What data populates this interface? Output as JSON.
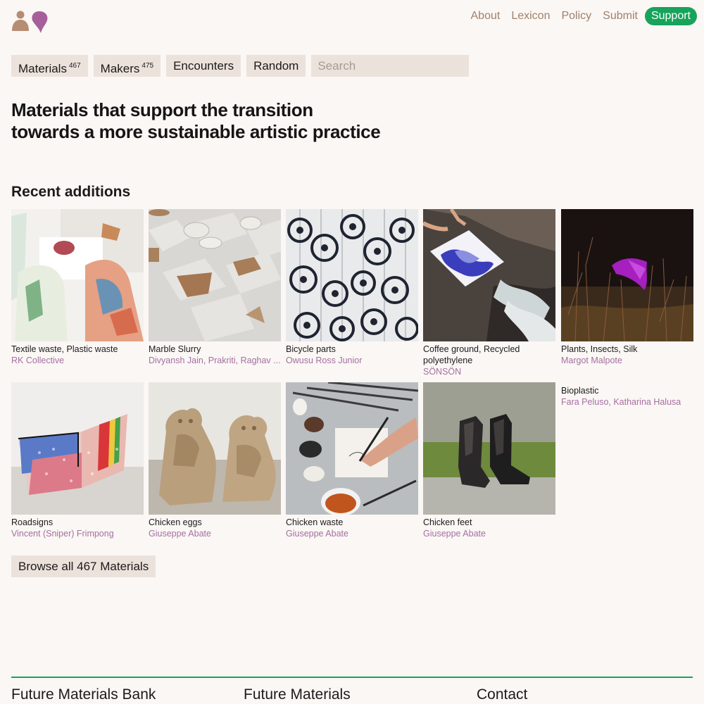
{
  "header": {
    "nav": [
      {
        "label": "About",
        "name": "about"
      },
      {
        "label": "Lexicon",
        "name": "lexicon"
      },
      {
        "label": "Policy",
        "name": "policy"
      },
      {
        "label": "Submit",
        "name": "submit"
      }
    ],
    "support_label": "Support",
    "accent_color": "#17a35a"
  },
  "filters": {
    "materials_label": "Materials",
    "materials_count": "467",
    "makers_label": "Makers",
    "makers_count": "475",
    "encounters_label": "Encounters",
    "random_label": "Random",
    "search_placeholder": "Search"
  },
  "headline": {
    "line1": "Materials that support the transition",
    "line2": "towards a more sustainable artistic practice"
  },
  "recent": {
    "title": "Recent additions",
    "items": [
      {
        "title": "Textile waste, Plastic waste",
        "maker": "RK Collective"
      },
      {
        "title": "Marble Slurry",
        "maker": "Divyansh Jain, Prakriti, Raghav ..."
      },
      {
        "title": "Bicycle parts",
        "maker": "Owusu Ross Junior"
      },
      {
        "title": "Coffee ground, Recycled polyethylene",
        "maker": "SÖNSÖN"
      },
      {
        "title": "Plants, Insects, Silk",
        "maker": "Margot Malpote"
      },
      {
        "title": "Roadsigns",
        "maker": "Vincent (Sniper) Frimpong"
      },
      {
        "title": "Chicken eggs",
        "maker": "Giuseppe Abate"
      },
      {
        "title": "Chicken waste",
        "maker": "Giuseppe Abate"
      },
      {
        "title": "Chicken feet",
        "maker": "Giuseppe Abate"
      },
      {
        "title": "Bioplastic",
        "maker": "Fara Peluso, Katharina Halusa"
      }
    ]
  },
  "browse_label": "Browse all 467 Materials",
  "footer": {
    "col1": "Future Materials Bank",
    "col2": "Future Materials",
    "col3": "Contact"
  }
}
